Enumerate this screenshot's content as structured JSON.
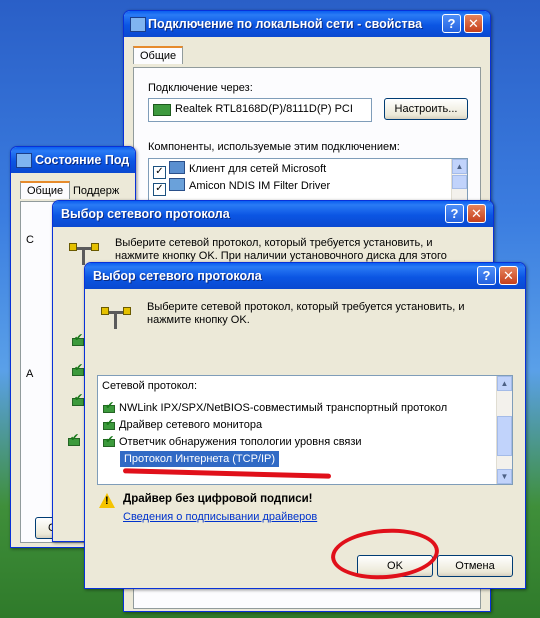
{
  "win_lan_props": {
    "title": "Подключение по локальной сети - свойства",
    "tab_general": "Общие",
    "connect_via_label": "Подключение через:",
    "adapter_name": "Realtek RTL8168D(P)/8111D(P) PCI",
    "configure_button": "Настроить...",
    "components_label": "Компоненты, используемые этим подключением:",
    "components": [
      {
        "label": "Клиент для сетей Microsoft",
        "checked": true
      },
      {
        "label": "Amicon NDIS IM Filter Driver",
        "checked": true
      }
    ]
  },
  "win_status": {
    "title": "Состояние Под",
    "tab_general": "Общие",
    "tab_support": "Поддерж",
    "letter_c": "С",
    "letter_a": "А",
    "properties_button": "Свойс"
  },
  "win_select_back": {
    "title": "Выбор сетевого протокола",
    "instruction": "Выберите сетевой протокол, который требуется установить, и нажмите кнопку OK. При наличии установочного диска для этого"
  },
  "win_select_front": {
    "title": "Выбор сетевого протокола",
    "instruction": "Выберите сетевой протокол, который требуется установить, и нажмите кнопку OK.",
    "list_header": "Сетевой протокол:",
    "protocols": [
      "NWLink IPX/SPX/NetBIOS-совместимый транспортный протокол",
      "Драйвер сетевого монитора",
      "Ответчик обнаружения топологии уровня связи",
      "Протокол Интернета (TCP/IP)"
    ],
    "selected_index": 3,
    "unsigned_warning": "Драйвер без цифровой подписи!",
    "signing_link": "Сведения о подписывании драйверов",
    "ok_button": "OK",
    "cancel_button": "Отмена"
  },
  "title_buttons": {
    "help": "?",
    "close": "✕"
  },
  "colors": {
    "highlight": "#316ac5",
    "annotation_red": "#e0101a",
    "link_blue": "#0033cc"
  }
}
